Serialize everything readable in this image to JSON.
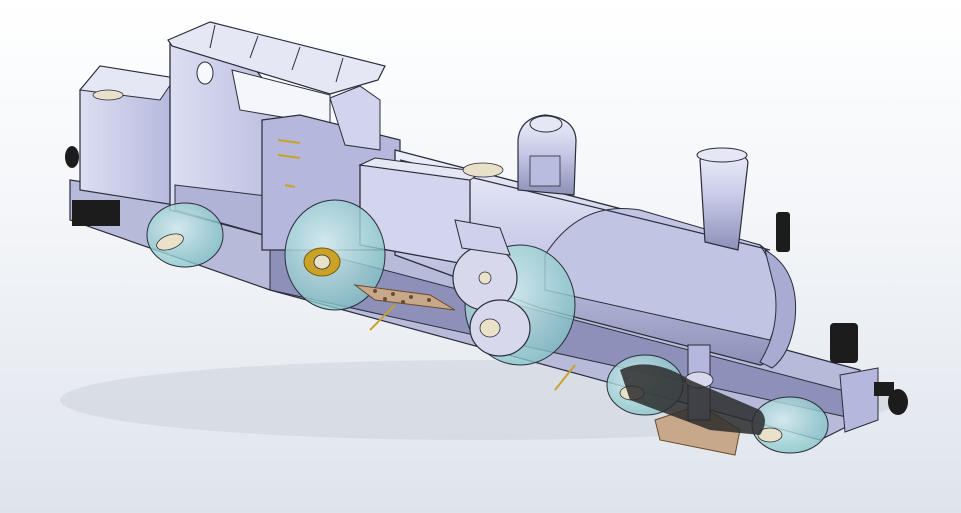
{
  "viewport": {
    "background_top": "#ffffff",
    "background_bottom": "#dfe4ec"
  },
  "model": {
    "colors": {
      "body": "#c9cbe8",
      "body_light": "#e6e7f5",
      "body_dark": "#8d90b8",
      "edge": "#2b2d3a",
      "wheel": "#9bd3d3",
      "axle": "#e9e2c8",
      "brass": "#c9a227",
      "brass_dark": "#7a5c10",
      "black": "#1c1c1c",
      "copper": "#c7a88a"
    },
    "wheels": 6,
    "buffers": 2
  }
}
